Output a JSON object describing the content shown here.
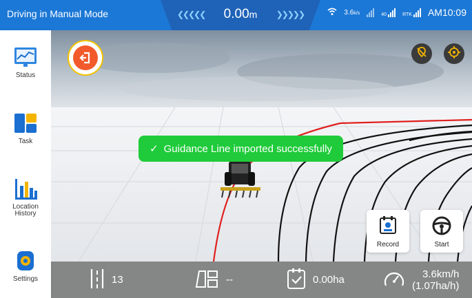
{
  "topbar": {
    "mode": "Driving in Manual Mode",
    "distance": "0.00",
    "distance_unit": "m",
    "wifi_speed": "3.6",
    "wifi_unit": "k/s",
    "signal_4g": "40",
    "rtk_label": "RTK",
    "time": "AM10:09"
  },
  "sidebar": {
    "items": [
      {
        "label": "Status",
        "icon": "status-chart-icon"
      },
      {
        "label": "Task",
        "icon": "task-icon"
      },
      {
        "label": "Location History",
        "icon": "location-history-icon"
      },
      {
        "label": "Settings",
        "icon": "settings-gear-icon"
      }
    ]
  },
  "toast": {
    "message": "Guidance Line imported successfully"
  },
  "actions": {
    "record_label": "Record",
    "start_label": "Start"
  },
  "bottombar": {
    "line_number": "13",
    "field_value": "--",
    "area": "0.00ha",
    "speed": "3.6km/h",
    "rate": "(1.07ha/h)"
  },
  "colors": {
    "topbar": "#1c78d6",
    "accent_green": "#1fcb3a",
    "exit_button": "#f25a2b",
    "guidance_red": "#e0201d"
  }
}
